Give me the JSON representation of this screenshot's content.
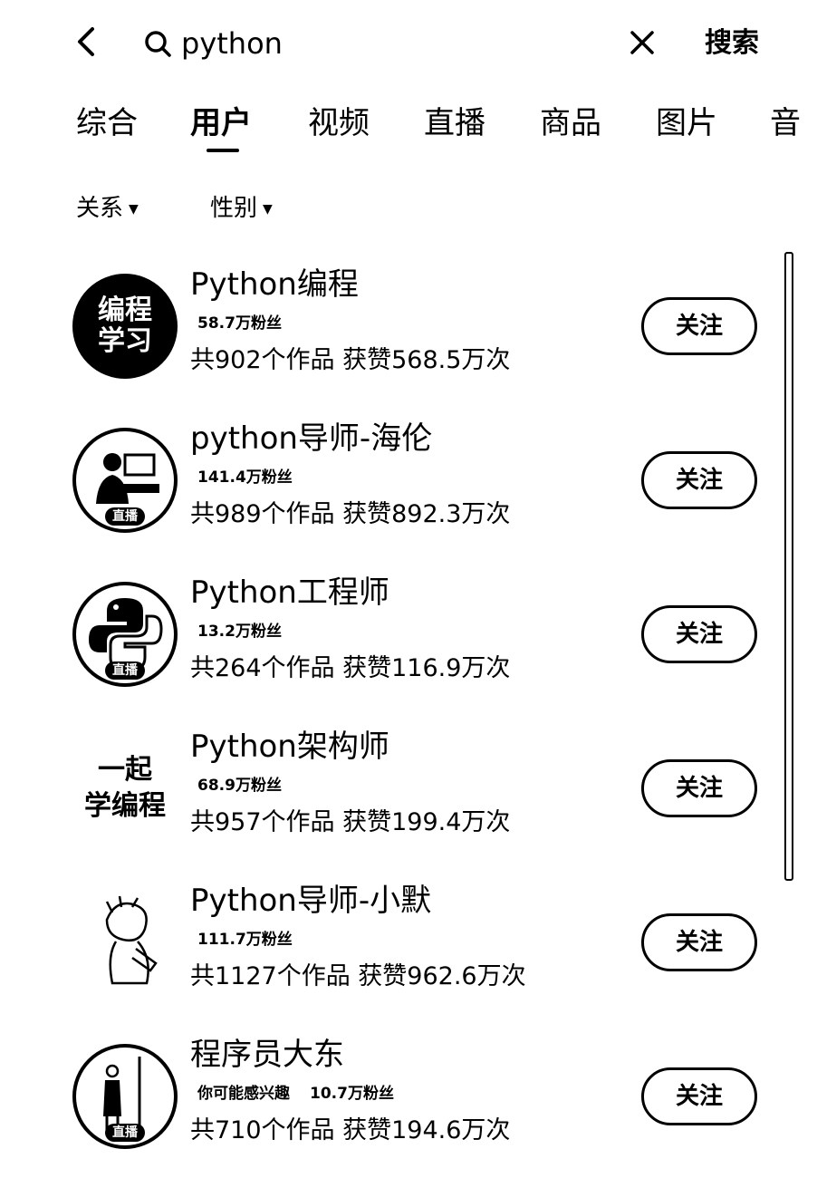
{
  "search": {
    "query": "python",
    "button": "搜索"
  },
  "tabs": [
    "综合",
    "用户",
    "视频",
    "直播",
    "商品",
    "图片",
    "音"
  ],
  "filters": [
    "关系",
    "性别"
  ],
  "users": [
    {
      "name": "Python编程",
      "tag": "",
      "fans": "58.7万粉丝",
      "stats": "共902个作品 获赞568.5万次",
      "follow": "关注",
      "avatar_text": [
        "编程",
        "学习"
      ],
      "live": ""
    },
    {
      "name": "python导师-海伦",
      "tag": "",
      "fans": "141.4万粉丝",
      "stats": "共989个作品 获赞892.3万次",
      "follow": "关注",
      "avatar_text": [],
      "live": "直播"
    },
    {
      "name": "Python工程师",
      "tag": "",
      "fans": "13.2万粉丝",
      "stats": "共264个作品 获赞116.9万次",
      "follow": "关注",
      "avatar_text": [],
      "live": "直播"
    },
    {
      "name": "Python架构师",
      "tag": "",
      "fans": "68.9万粉丝",
      "stats": "共957个作品 获赞199.4万次",
      "follow": "关注",
      "avatar_text": [
        "一起",
        "学编程"
      ],
      "live": ""
    },
    {
      "name": "Python导师-小默",
      "tag": "",
      "fans": "111.7万粉丝",
      "stats": "共1127个作品 获赞962.6万次",
      "follow": "关注",
      "avatar_text": [],
      "live": ""
    },
    {
      "name": "程序员大东",
      "tag": "你可能感兴趣",
      "fans": "10.7万粉丝",
      "stats": "共710个作品 获赞194.6万次",
      "follow": "关注",
      "avatar_text": [],
      "live": "直播"
    }
  ],
  "icons": {
    "back": "chevron-left-icon",
    "search": "search-icon",
    "clear": "close-icon",
    "caret": "caret-down-icon"
  }
}
